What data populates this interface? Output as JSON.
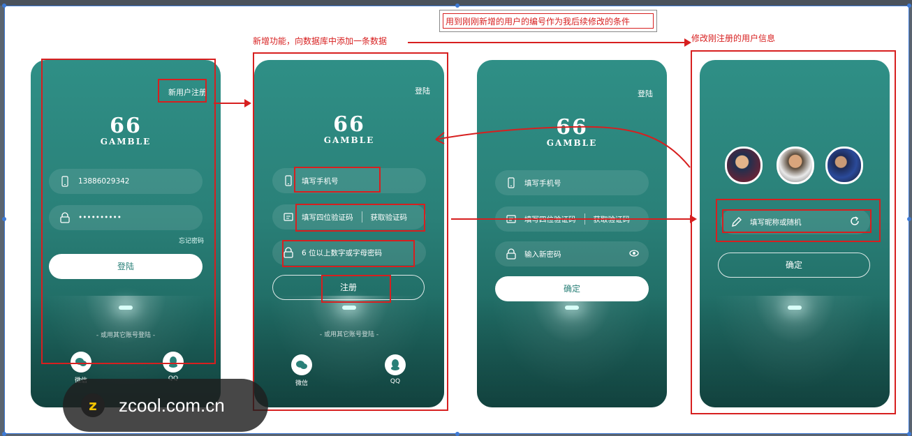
{
  "annotations": {
    "top_note": "用到刚刚新增的用户的编号作为我后续修改的条件",
    "add_note": "新增功能，向数据库中添加一条数据",
    "edit_note": "修改刚注册的用户信息"
  },
  "screen1": {
    "corner_link": "新用户注册",
    "logo_number": "66",
    "logo_word": "GAMBLE",
    "phone_value": "13886029342",
    "password_value": "••••••••••",
    "forgot_label": "忘记密码",
    "login_label": "登陆",
    "other_login": "- 或用其它账号登陆 -",
    "wechat_label": "微信",
    "qq_label": "QQ"
  },
  "screen2": {
    "corner_link": "登陆",
    "logo_number": "66",
    "logo_word": "GAMBLE",
    "phone_placeholder": "填写手机号",
    "code_placeholder": "填写四位验证码",
    "get_code_label": "获取验证码",
    "password_placeholder": "6 位以上数字或字母密码",
    "register_label": "注册",
    "other_login": "- 或用其它账号登陆 -",
    "wechat_label": "微信",
    "qq_label": "QQ"
  },
  "screen3": {
    "corner_link": "登陆",
    "logo_number": "66",
    "logo_word": "GAMBLE",
    "phone_placeholder": "填写手机号",
    "code_placeholder": "填写四位验证码",
    "get_code_label": "获取验证码",
    "password_placeholder": "输入新密码",
    "confirm_label": "确定"
  },
  "screen4": {
    "nickname_placeholder": "填写昵称或随机",
    "confirm_label": "确定"
  },
  "watermark": {
    "logo_letter": "z",
    "site": "zcool.com.cn"
  },
  "colors": {
    "annotation_red": "#d71f1f",
    "phone_teal": "#2a8078",
    "selection_blue": "#3d7ad6"
  }
}
